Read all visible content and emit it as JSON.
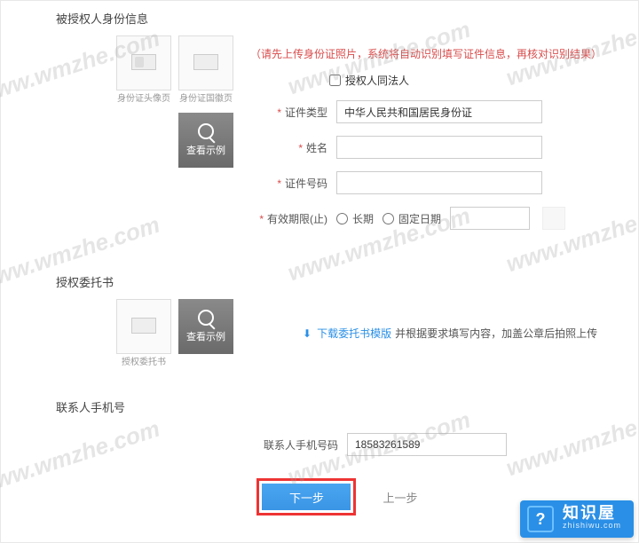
{
  "watermark": "www.wmzhe.com",
  "section1": {
    "title": "被授权人身份信息",
    "upload_front": "身份证头像页",
    "upload_back": "身份证国徽页",
    "example": "查看示例",
    "hint": "（请先上传身份证照片，系统将自动识别填写证件信息，再核对识别结果）",
    "legal_person": "授权人同法人",
    "cert_type_label": "证件类型",
    "cert_type_value": "中华人民共和国居民身份证",
    "name_label": "姓名",
    "name_value": "",
    "cert_no_label": "证件号码",
    "cert_no_value": "",
    "valid_label": "有效期限(止)",
    "opt_long": "长期",
    "opt_fixed": "固定日期",
    "date_value": ""
  },
  "section2": {
    "title": "授权委托书",
    "upload_auth": "授权委托书",
    "example": "查看示例",
    "download_link": "下载委托书模版",
    "download_tail": " 并根据要求填写内容，加盖公章后拍照上传"
  },
  "section3": {
    "title": "联系人手机号",
    "phone_label": "联系人手机号码",
    "phone_value": "18583261589"
  },
  "buttons": {
    "next": "下一步",
    "prev": "上一步"
  },
  "badge": {
    "title": "知识屋",
    "sub": "zhishiwu.com"
  }
}
